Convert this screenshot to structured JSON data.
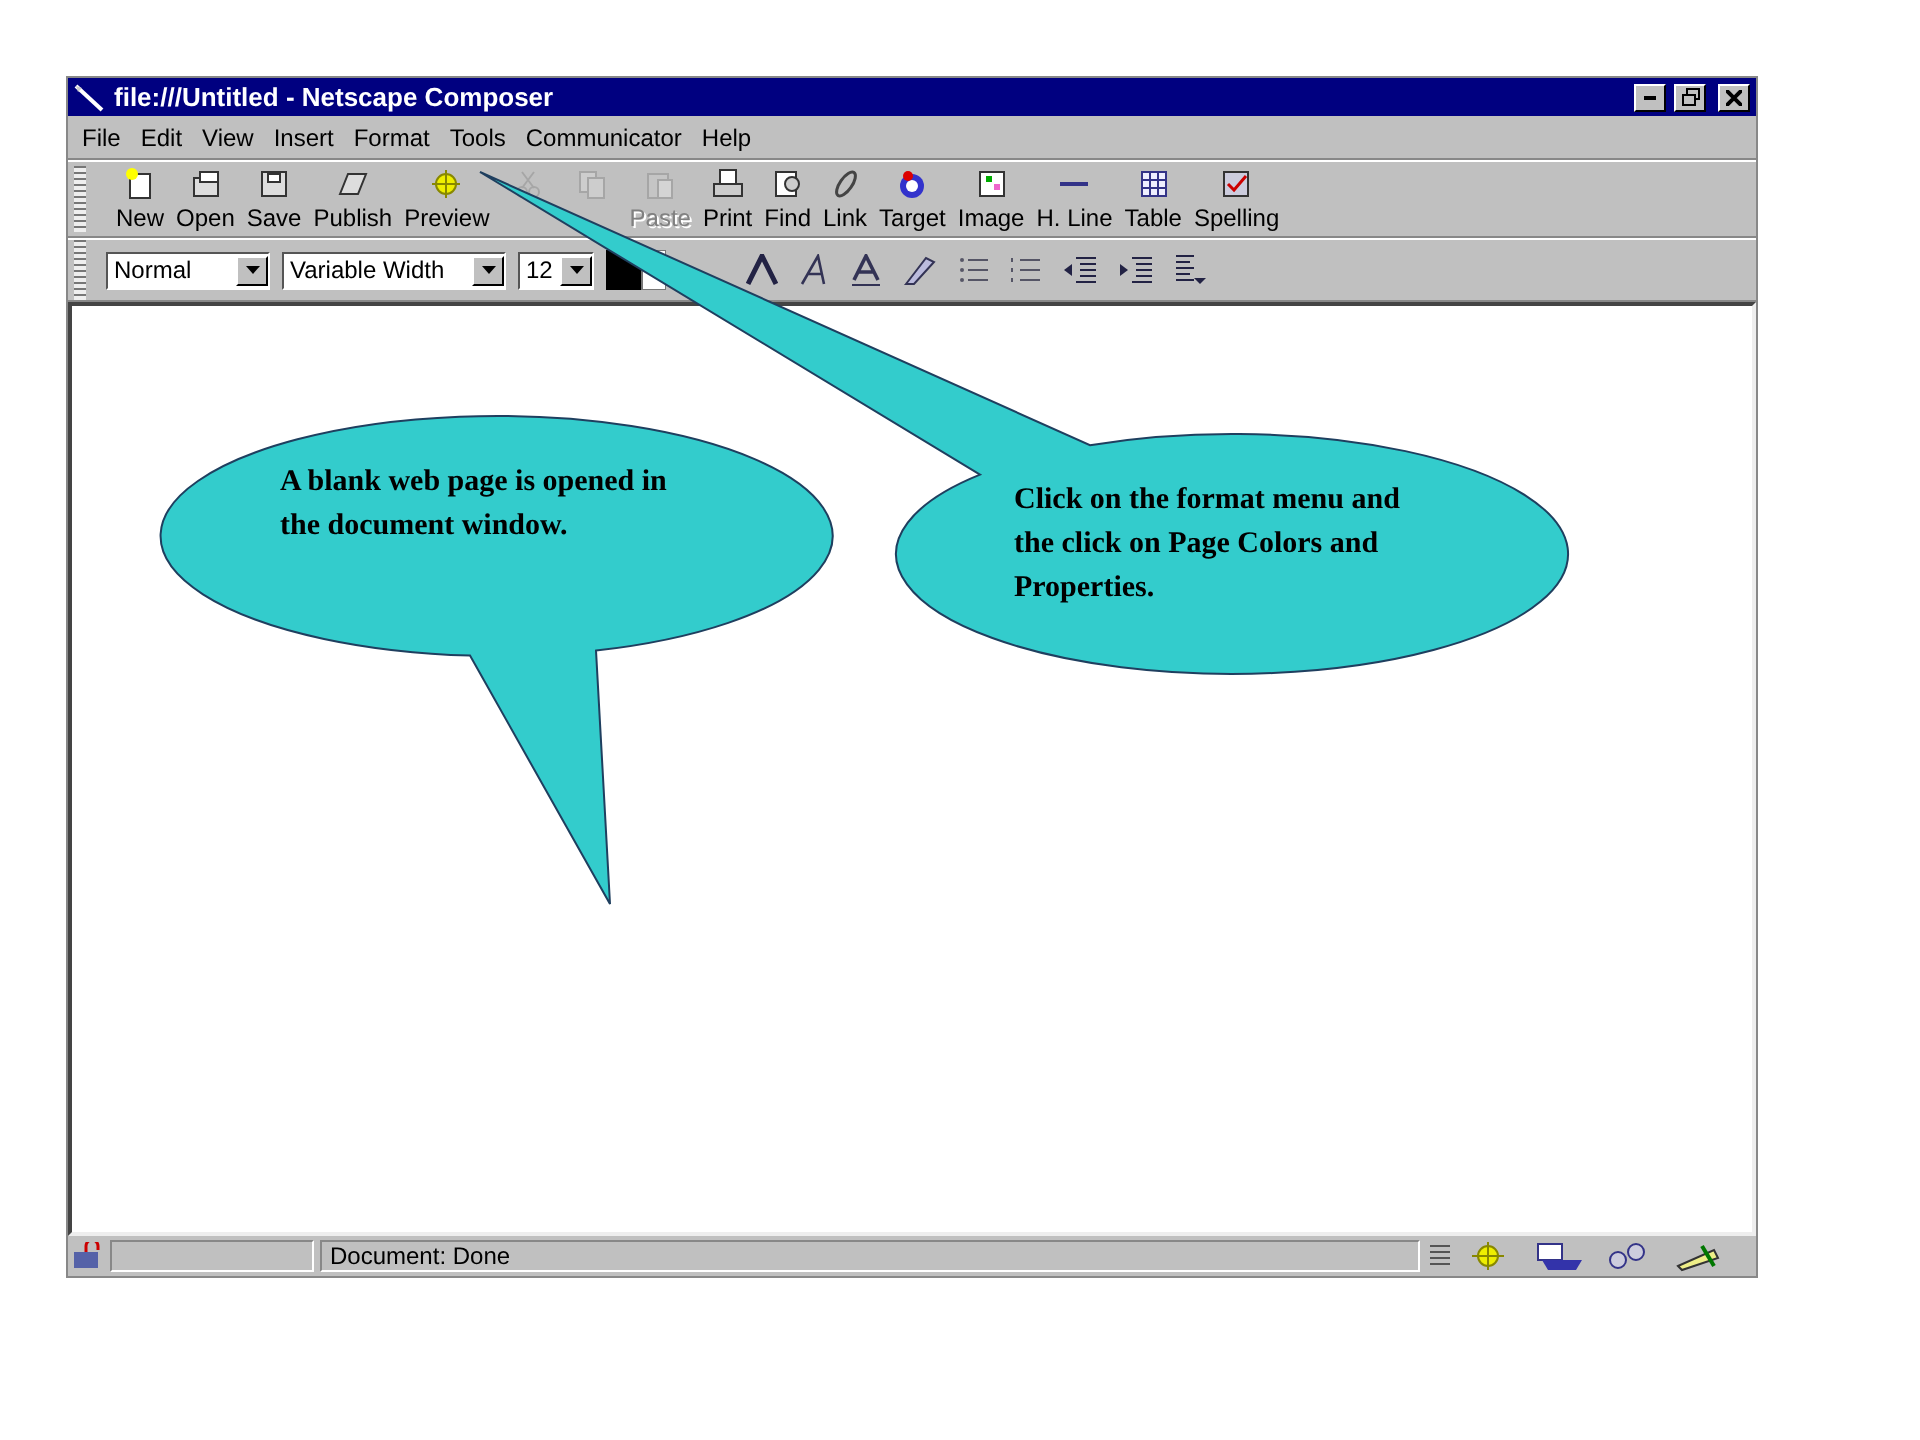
{
  "window": {
    "title": "file:///Untitled - Netscape Composer"
  },
  "menu": [
    {
      "label": "File"
    },
    {
      "label": "Edit"
    },
    {
      "label": "View"
    },
    {
      "label": "Insert"
    },
    {
      "label": "Format"
    },
    {
      "label": "Tools"
    },
    {
      "label": "Communicator"
    },
    {
      "label": "Help"
    }
  ],
  "toolbar": [
    {
      "kind": "new",
      "label": "New",
      "disabled": false
    },
    {
      "kind": "open",
      "label": "Open",
      "disabled": false
    },
    {
      "kind": "save",
      "label": "Save",
      "disabled": false
    },
    {
      "kind": "publish",
      "label": "Publish",
      "disabled": false
    },
    {
      "kind": "preview",
      "label": "Preview",
      "disabled": false
    },
    {
      "kind": "cut",
      "disabled": true
    },
    {
      "kind": "copy",
      "disabled": true
    },
    {
      "kind": "paste",
      "label": "Paste",
      "disabled": true
    },
    {
      "kind": "print",
      "label": "Print",
      "disabled": false
    },
    {
      "kind": "find",
      "label": "Find",
      "disabled": false
    },
    {
      "kind": "link",
      "label": "Link",
      "disabled": false
    },
    {
      "kind": "target",
      "label": "Target",
      "disabled": false
    },
    {
      "kind": "image",
      "label": "Image",
      "disabled": false
    },
    {
      "kind": "hline",
      "label": "H. Line",
      "disabled": false
    },
    {
      "kind": "table",
      "label": "Table",
      "disabled": false
    },
    {
      "kind": "spelling",
      "label": "Spelling",
      "disabled": false
    }
  ],
  "format_bar": {
    "paragraph_style": "Normal",
    "font": "Variable Width",
    "size": "12"
  },
  "status_bar": {
    "text": "Document: Done"
  },
  "callouts": [
    {
      "text": "A blank web page is opened in the document window."
    },
    {
      "text": "Click on the format menu and the click on Page Colors and Properties."
    }
  ]
}
